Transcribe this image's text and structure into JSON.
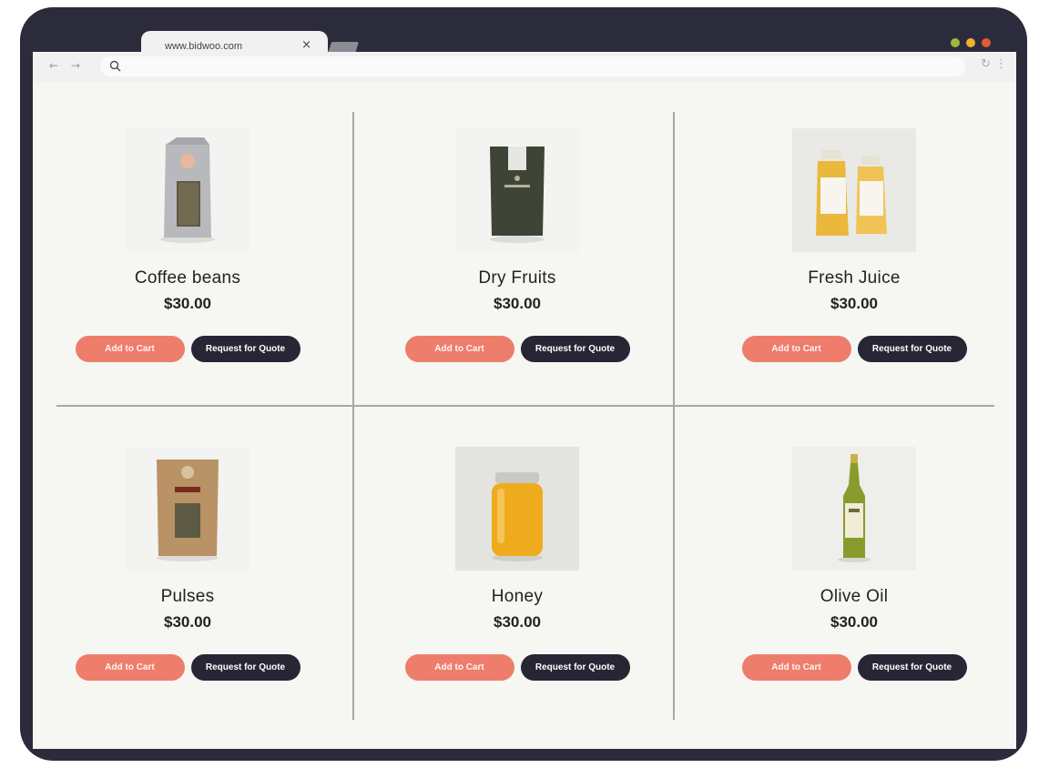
{
  "browser": {
    "tab_title": "www.bidwoo.com",
    "tab_close": "×",
    "dot_colors": [
      "#9cb93d",
      "#f0b12c",
      "#e25a34"
    ],
    "icons": [
      "back-arrow-icon",
      "forward-arrow-icon",
      "search-icon",
      "reload-icon",
      "menu-kebab-icon"
    ]
  },
  "colors": {
    "frame": "#2c2b3c",
    "add_to_cart": "#ee7d6b",
    "request_quote": "#262634",
    "page_bg": "#f6f6f3"
  },
  "products": [
    {
      "name": "Coffee beans",
      "price": "$30.00",
      "cart_label": "Add to Cart",
      "quote_label": "Request for Quote",
      "image": "coffee-bag"
    },
    {
      "name": "Dry Fruits",
      "price": "$30.00",
      "cart_label": "Add to Cart",
      "quote_label": "Request for Quote",
      "image": "dark-pouch"
    },
    {
      "name": "Fresh Juice",
      "price": "$30.00",
      "cart_label": "Add to Cart",
      "quote_label": "Request for Quote",
      "image": "juice-bottles"
    },
    {
      "name": "Pulses",
      "price": "$30.00",
      "cart_label": "Add to Cart",
      "quote_label": "Request for Quote",
      "image": "kraft-bag"
    },
    {
      "name": "Honey",
      "price": "$30.00",
      "cart_label": "Add to Cart",
      "quote_label": "Request for Quote",
      "image": "honey-jar"
    },
    {
      "name": "Olive Oil",
      "price": "$30.00",
      "cart_label": "Add to Cart",
      "quote_label": "Request for Quote",
      "image": "olive-oil-bottle"
    }
  ]
}
